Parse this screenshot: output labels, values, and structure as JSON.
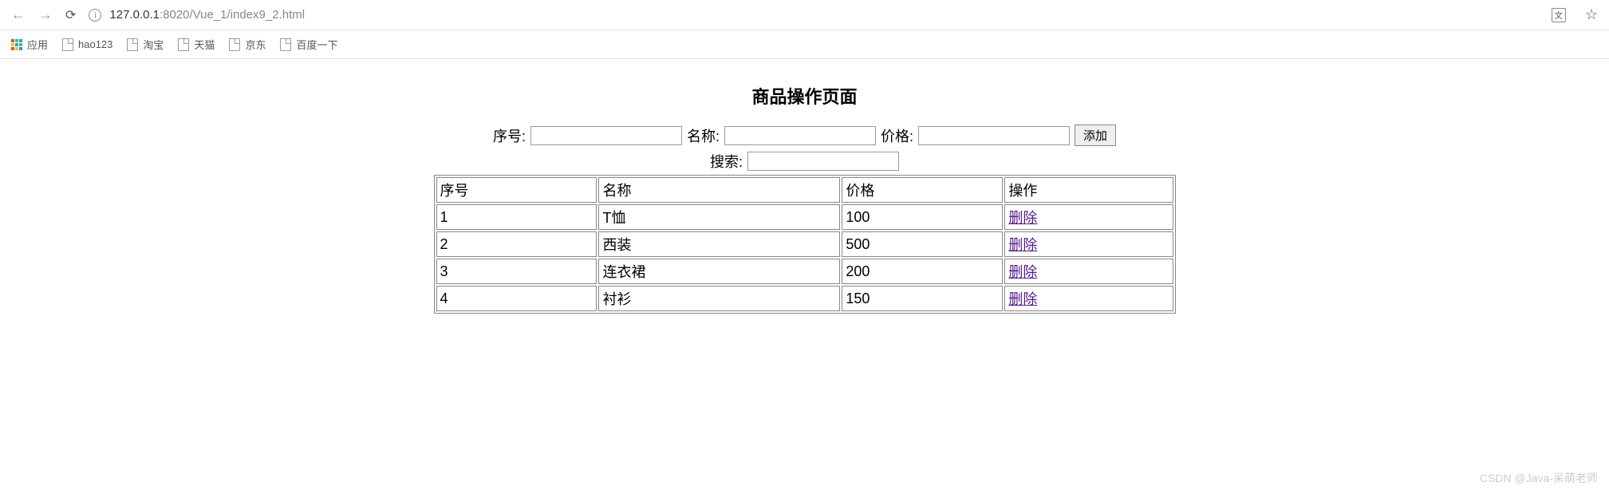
{
  "browser": {
    "url_host": "127.0.0.1",
    "url_port": ":8020",
    "url_path": "/Vue_1/index9_2.html"
  },
  "bookmarks": {
    "apps_label": "应用",
    "items": [
      {
        "label": "hao123"
      },
      {
        "label": "淘宝"
      },
      {
        "label": "天猫"
      },
      {
        "label": "京东"
      },
      {
        "label": "百度一下"
      }
    ]
  },
  "page": {
    "title": "商品操作页面",
    "form": {
      "id_label": "序号:",
      "name_label": "名称:",
      "price_label": "价格:",
      "add_button": "添加"
    },
    "search_label": "搜索:",
    "table": {
      "headers": [
        "序号",
        "名称",
        "价格",
        "操作"
      ],
      "delete_label": "删除",
      "rows": [
        {
          "id": "1",
          "name": "T恤",
          "price": "100"
        },
        {
          "id": "2",
          "name": "西装",
          "price": "500"
        },
        {
          "id": "3",
          "name": "连衣裙",
          "price": "200"
        },
        {
          "id": "4",
          "name": "衬衫",
          "price": "150"
        }
      ]
    }
  },
  "watermark": "CSDN @Java-呆萌老师"
}
